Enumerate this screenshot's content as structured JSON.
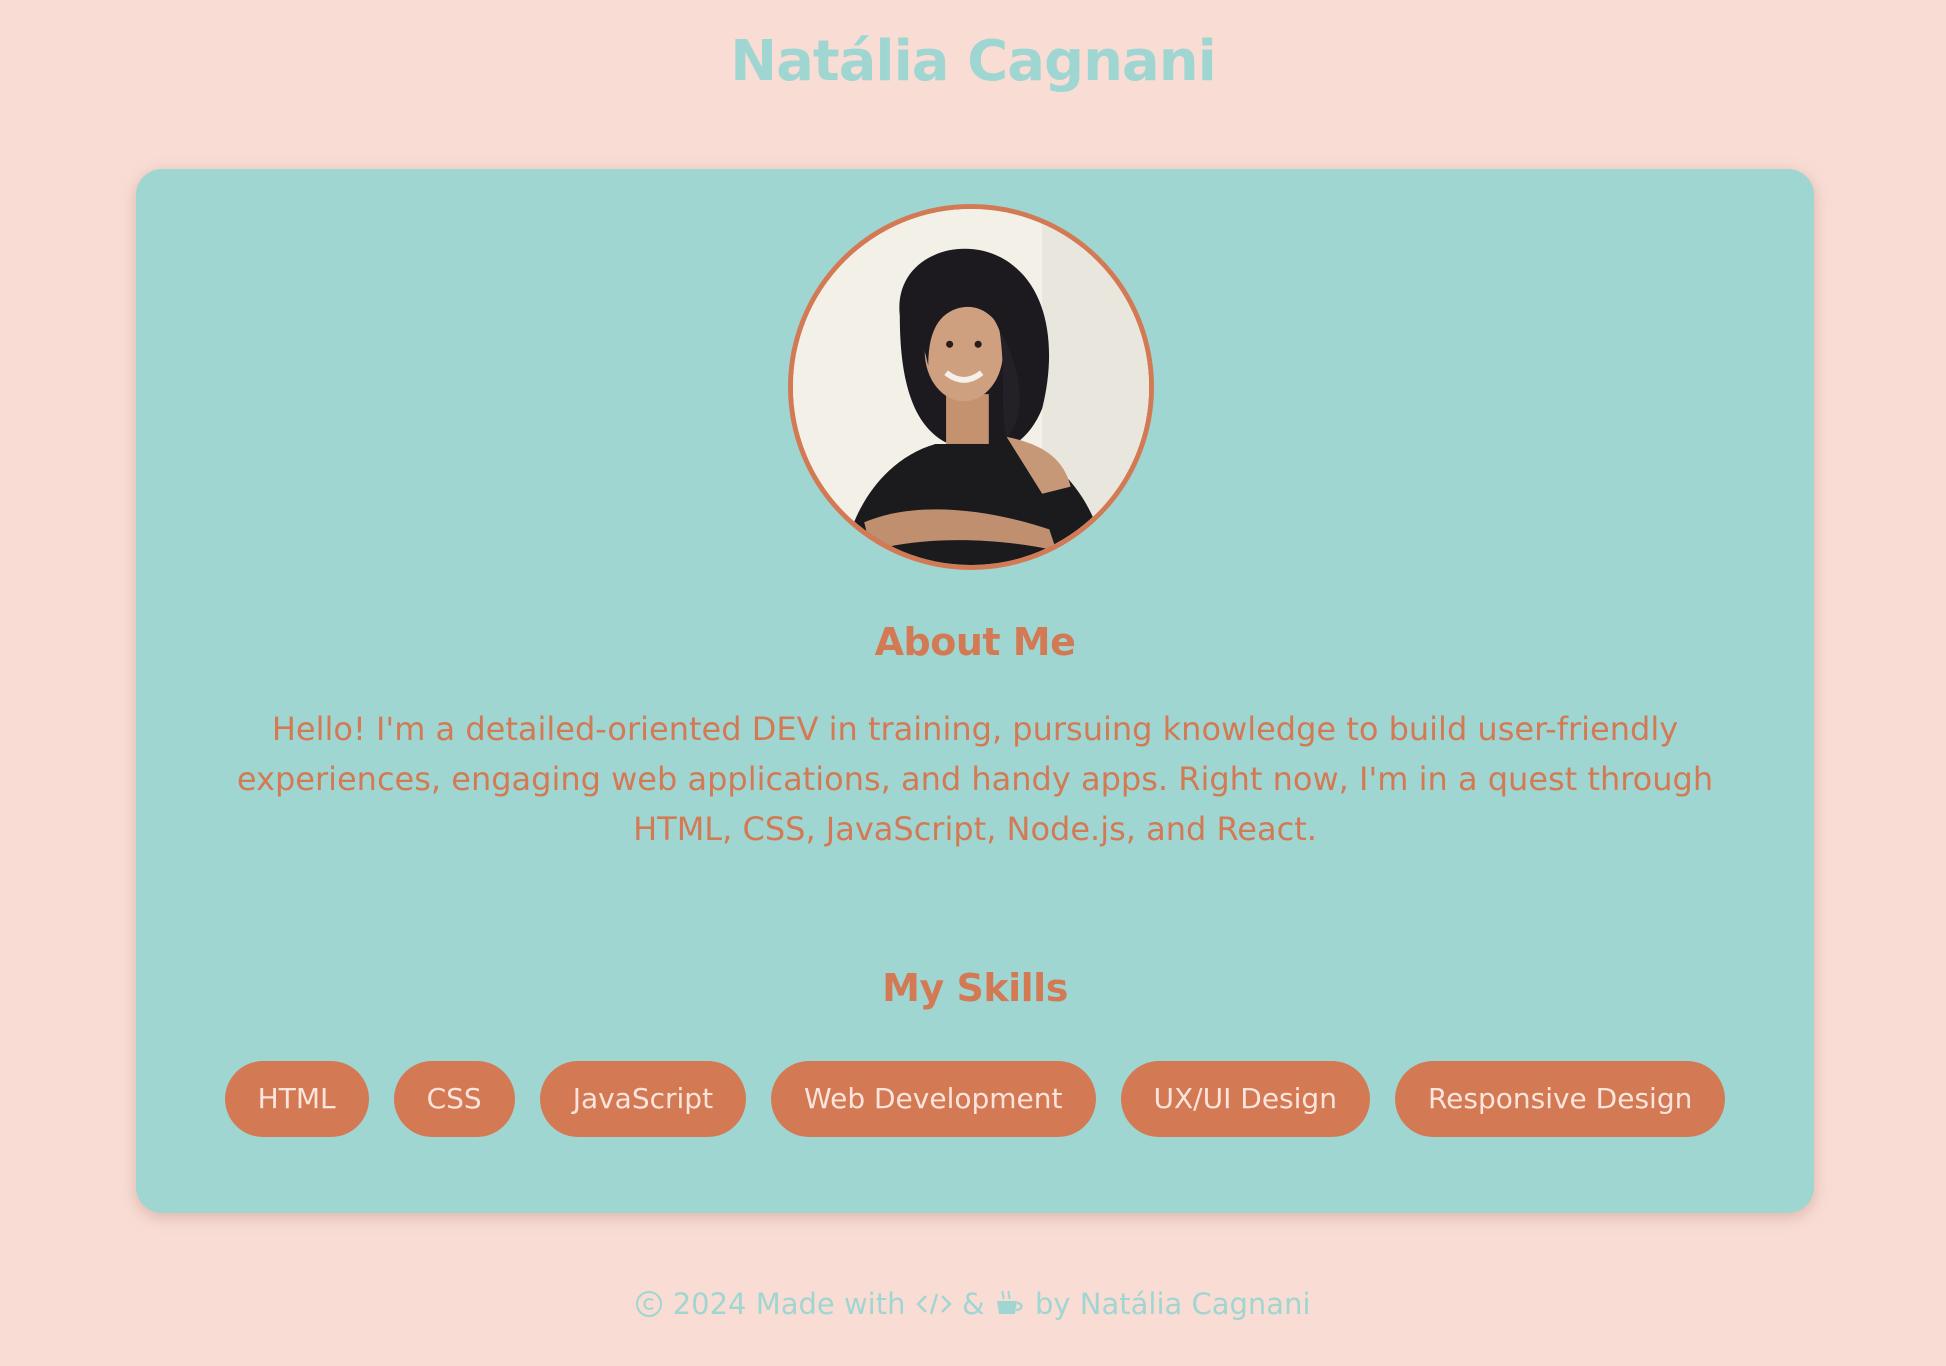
{
  "header": {
    "title": "Natália Cagnani"
  },
  "about": {
    "heading": "About Me",
    "text": "Hello! I'm a detailed-oriented DEV in training, pursuing knowledge to build user-friendly experiences, engaging web applications, and handy apps. Right now, I'm in a quest through HTML, CSS, JavaScript, Node.js, and React."
  },
  "skills": {
    "heading": "My Skills",
    "items": [
      "HTML",
      "CSS",
      "JavaScript",
      "Web Development",
      "UX/UI Design",
      "Responsive Design"
    ]
  },
  "footer": {
    "copyright_icon": "copyright-icon",
    "year_text": "2024 Made with",
    "code_icon": "code-icon",
    "ampersand": "&",
    "coffee_icon": "coffee-icon",
    "by_text": "by Natália Cagnani"
  },
  "colors": {
    "background": "#f9ddd5",
    "card": "#a0d6d2",
    "accent": "#d37a55"
  }
}
